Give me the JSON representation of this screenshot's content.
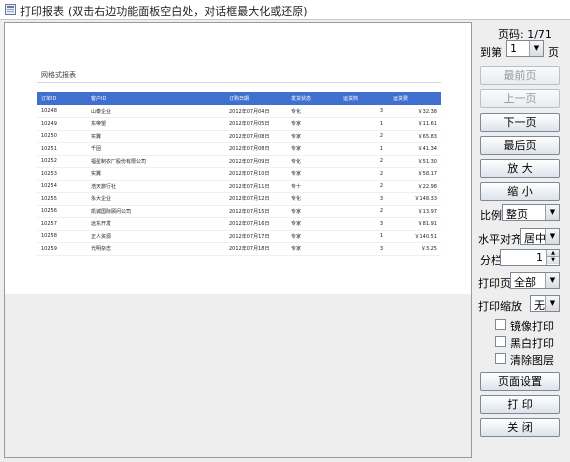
{
  "window": {
    "title": "打印报表",
    "hint": "(双击右边功能面板空白处，对话框最大化或还原)"
  },
  "report": {
    "title": "网格式报表",
    "columns": [
      "订单ID",
      "客户ID",
      "订购日期",
      "发货状态",
      "运货商",
      "运货费"
    ],
    "rows": [
      [
        "10248",
        "山泰企业",
        "2012年07月04日",
        "专化",
        "3",
        "￥32.38"
      ],
      [
        "10249",
        "东帝望",
        "2012年07月05日",
        "专家",
        "1",
        "￥11.61"
      ],
      [
        "10250",
        "实翼",
        "2012年07月08日",
        "专家",
        "2",
        "￥65.83"
      ],
      [
        "10251",
        "千固",
        "2012年07月08日",
        "专家",
        "1",
        "￥41.34"
      ],
      [
        "10252",
        "福星制衣厂股份有限公司",
        "2012年07月09日",
        "专化",
        "2",
        "￥51.30"
      ],
      [
        "10253",
        "实翼",
        "2012年07月10日",
        "专家",
        "2",
        "￥58.17"
      ],
      [
        "10254",
        "浩天旅行社",
        "2012年07月11日",
        "专十",
        "2",
        "￥22.98"
      ],
      [
        "10255",
        "永大企业",
        "2012年07月12日",
        "专化",
        "3",
        "￥148.33"
      ],
      [
        "10256",
        "凯诚国际顾问公司",
        "2012年07月15日",
        "专家",
        "2",
        "￥13.97"
      ],
      [
        "10257",
        "远东开发",
        "2012年07月16日",
        "专家",
        "3",
        "￥81.91"
      ],
      [
        "10258",
        "正人资源",
        "2012年07月17日",
        "专家",
        "1",
        "￥140.51"
      ],
      [
        "10259",
        "光明杂志",
        "2012年07月18日",
        "专家",
        "3",
        "￥3.25"
      ]
    ]
  },
  "panel": {
    "page_code": "页码: 1/71",
    "goto_prefix": "到第",
    "goto_value": "1",
    "goto_suffix": "页",
    "first_page": "最前页",
    "prev_page": "上一页",
    "next_page": "下一页",
    "last_page": "最后页",
    "zoom_in": "放 大",
    "zoom_out": "缩 小",
    "scale_label": "比例",
    "scale_value": "整页",
    "halign_label": "水平对齐",
    "halign_value": "居中",
    "columns_label": "分栏",
    "columns_value": "1",
    "print_pages_label": "打印页",
    "print_pages_value": "全部",
    "print_scale_label": "打印缩放",
    "print_scale_value": "无",
    "mirror_label": "镜像打印",
    "bw_label": "黑白打印",
    "clear_layer_label": "清除图层",
    "page_setup": "页面设置",
    "print": "打 印",
    "close": "关 闭"
  }
}
